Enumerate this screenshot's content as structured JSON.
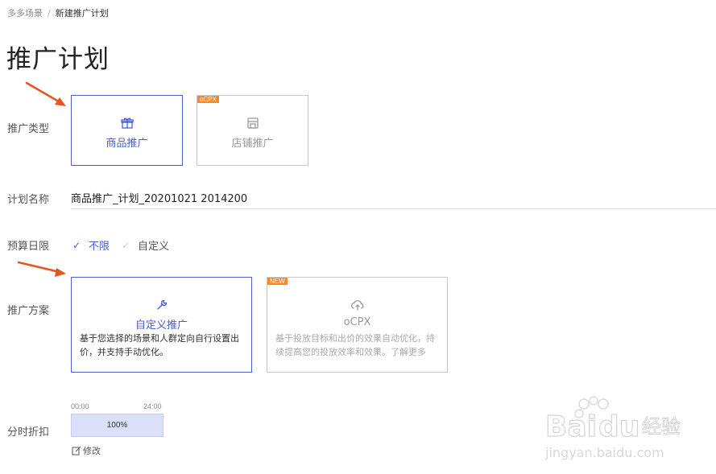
{
  "breadcrumb": {
    "parent": "多多场景",
    "separator": "/",
    "current": "新建推广计划"
  },
  "page_title": "推广计划",
  "promo_type": {
    "label": "推广类型",
    "options": [
      {
        "label": "商品推广",
        "icon": "gift-icon",
        "selected": true
      },
      {
        "label": "店铺推广",
        "icon": "store-icon",
        "tag": "oCPX",
        "selected": false
      }
    ]
  },
  "plan_name": {
    "label": "计划名称",
    "value": "商品推广_计划_20201021 2014200"
  },
  "budget": {
    "label": "预算日限",
    "options": [
      {
        "label": "不限",
        "selected": true
      },
      {
        "label": "自定义",
        "selected": false
      }
    ]
  },
  "scheme": {
    "label": "推广方案",
    "options": [
      {
        "title": "自定义推广",
        "icon": "wrench-icon",
        "desc_line1": "基于您选择的场景和人群定向自行设置出",
        "desc_line2": "价，并支持手动优化。",
        "selected": true
      },
      {
        "title": "oCPX",
        "icon": "cloud-sync-icon",
        "tag": "NEW",
        "desc_line1": "基于投放目标和出价的效果自动优化，持",
        "desc_line2": "续提高您的投放效率和效果。了解更多",
        "selected": false
      }
    ]
  },
  "time_discount": {
    "label": "分时折扣",
    "start": "00:00",
    "end": "24:00",
    "value": "100%",
    "edit_label": "修改"
  },
  "watermark": {
    "brand": "Baidu经验",
    "url": "jingyan.baidu.com"
  },
  "colors": {
    "accent": "#4a5fd1",
    "tag": "#f5892b",
    "arrow": "#e8541e",
    "time_bar": "#dcdff8"
  }
}
